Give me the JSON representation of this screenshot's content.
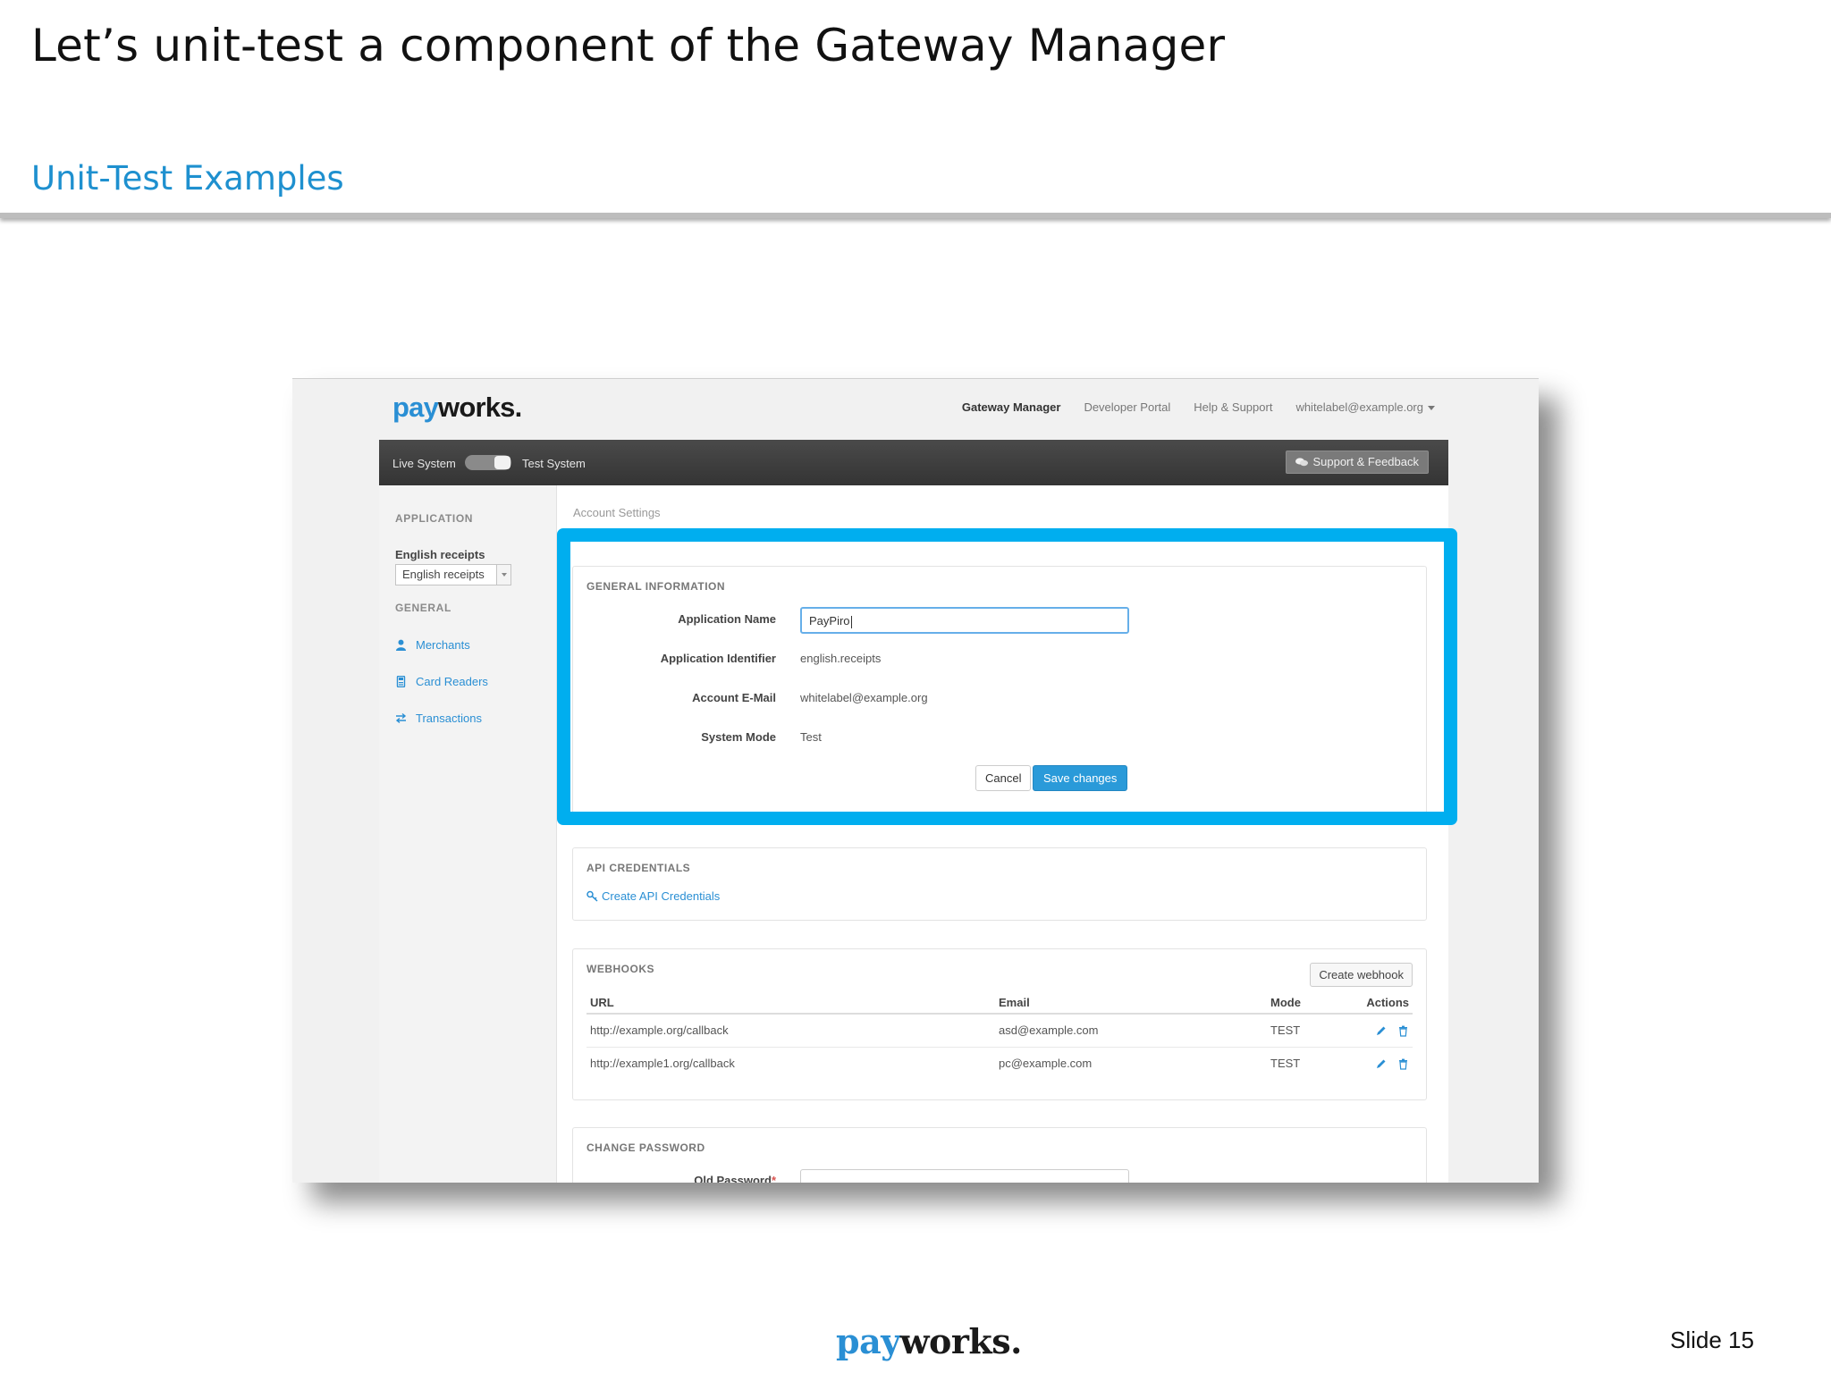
{
  "slide": {
    "title": "Let’s unit-test a component of the Gateway Manager",
    "subtitle": "Unit-Test  Examples",
    "footer_logo": {
      "pay": "pay",
      "works": "works."
    },
    "slide_number": "Slide 15"
  },
  "app": {
    "logo": {
      "pay": "pay",
      "works": "works."
    },
    "topnav": {
      "items": [
        "Gateway Manager",
        "Developer Portal",
        "Help & Support"
      ],
      "account": "whitelabel@example.org"
    },
    "systembar": {
      "live_label": "Live System",
      "test_label": "Test System",
      "support_button": "Support & Feedback"
    },
    "sidebar": {
      "application_heading": "APPLICATION",
      "application_name": "English receipts",
      "application_select_value": "English receipts",
      "general_heading": "GENERAL",
      "links": [
        "Merchants",
        "Card Readers",
        "Transactions"
      ]
    },
    "breadcrumb": "Account Settings",
    "general_info": {
      "heading": "GENERAL INFORMATION",
      "app_name_label": "Application Name",
      "app_name_value": "PayPiro",
      "app_id_label": "Application Identifier",
      "app_id_value": "english.receipts",
      "email_label": "Account E-Mail",
      "email_value": "whitelabel@example.org",
      "mode_label": "System Mode",
      "mode_value": "Test",
      "cancel_button": "Cancel",
      "save_button": "Save changes"
    },
    "api_credentials": {
      "heading": "API CREDENTIALS",
      "create_link": "Create API Credentials"
    },
    "webhooks": {
      "heading": "WEBHOOKS",
      "create_button": "Create webhook",
      "columns": {
        "url": "URL",
        "email": "Email",
        "mode": "Mode",
        "actions": "Actions"
      },
      "rows": [
        {
          "url": "http://example.org/callback",
          "email": "asd@example.com",
          "mode": "TEST"
        },
        {
          "url": "http://example1.org/callback",
          "email": "pc@example.com",
          "mode": "TEST"
        }
      ]
    },
    "change_password": {
      "heading": "CHANGE PASSWORD",
      "old_password_label": "Old Password",
      "required_mark": "*"
    },
    "colors": {
      "accent": "#00aeef",
      "link": "#2a8fd4",
      "primary_button": "#2a9ad9"
    }
  }
}
